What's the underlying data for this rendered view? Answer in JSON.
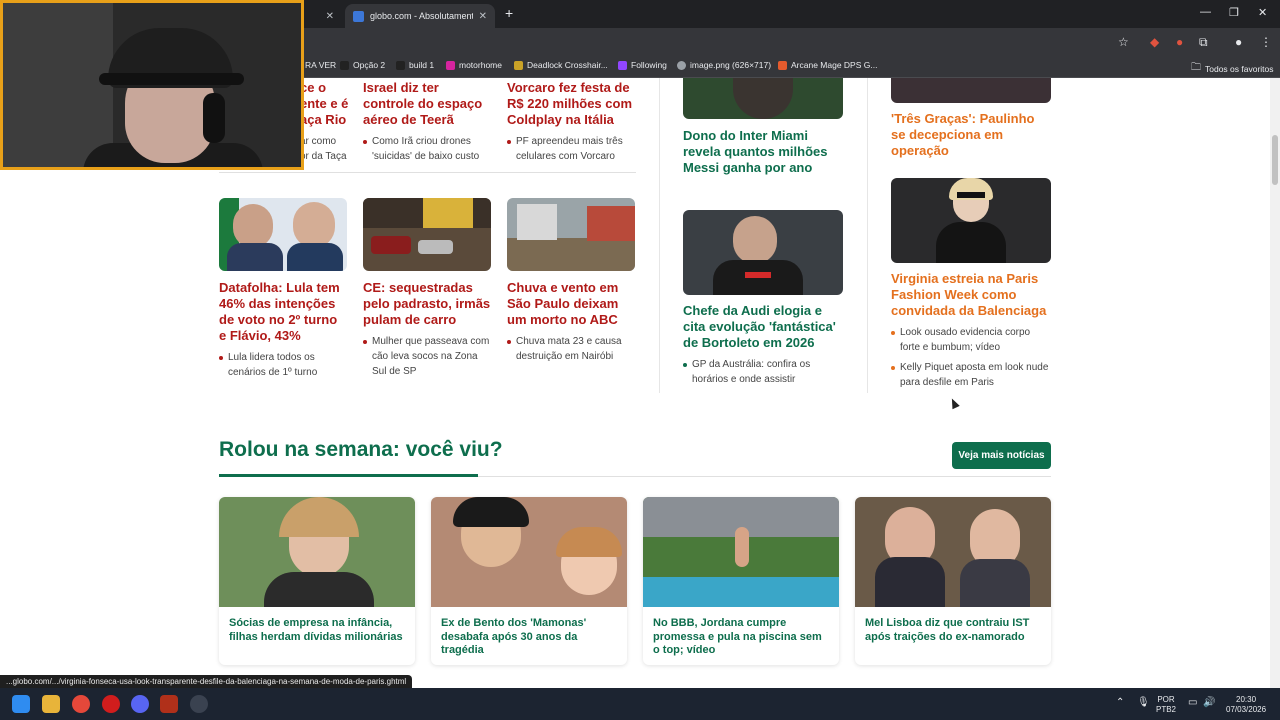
{
  "browser": {
    "inactive_tab_close": "✕",
    "active_tab_title": "globo.com - Absolutamente tu",
    "active_tab_close": "✕",
    "new_tab": "+",
    "bookmarks": [
      {
        "label": "RA VER",
        "color": "#3a3a3a"
      },
      {
        "label": "Opção 2",
        "color": "#222222"
      },
      {
        "label": "build 1",
        "color": "#222222"
      },
      {
        "label": "motorhome",
        "color": "#d6249f"
      },
      {
        "label": "Deadlock Crosshair...",
        "color": "#c9a227"
      },
      {
        "label": "Following",
        "color": "#9146ff"
      },
      {
        "label": "image.png (626×717)",
        "color": "#9aa0a6"
      },
      {
        "label": "Arcane Mage DPS G...",
        "color": "#e55b2d"
      }
    ],
    "all_favorites": "Todos os favoritos",
    "status_url": "...globo.com/.../virginia-fonseca-usa-look-transparente-desfile-da-balenciaga-na-semana-de-moda-de-paris.ghtml"
  },
  "top_row": {
    "col1": {
      "lines": [
        "ce o",
        "ente e é",
        "aça Rio"
      ],
      "sub": [
        "ar como",
        "or da Taça"
      ]
    },
    "col2": {
      "headline": "Israel diz ter controle do espaço aéreo de Teerã",
      "sub": "Como Irã criou drones 'suicidas' de baixo custo"
    },
    "col3": {
      "headline": "Vorcaro fez festa de R$ 220 milhões com Coldplay na Itália",
      "sub": "PF apreendeu mais três celulares com Vorcaro"
    }
  },
  "mid_row": [
    {
      "headline": "Datafolha: Lula tem 46% das intenções de voto no 2º turno e Flávio, 43%",
      "sub": "Lula lidera todos os cenários de 1º turno"
    },
    {
      "headline": "CE: sequestradas pelo padrasto, irmãs pulam de carro",
      "sub": "Mulher que passeava com cão leva socos na Zona Sul de SP"
    },
    {
      "headline": "Chuva e vento em São Paulo deixam um morto  no ABC",
      "sub": "Chuva mata 23 e causa destruição em Nairóbi"
    }
  ],
  "sports": {
    "top_headline": "Dono do Inter Miami revela quantos milhões Messi ganha por ano",
    "headline": "Chefe da Audi elogia e cita evolução 'fantástica' de Bortoleto em 2026",
    "sub": "GP da Austrália: confira os horários e onde assistir"
  },
  "entertainment": {
    "top_headline": "'Três Graças': Paulinho se decepciona em operação",
    "headline": "Virginia estreia na Paris Fashion Week como convidada da Balenciaga",
    "subs": [
      "Look ousado evidencia corpo forte e bumbum; vídeo",
      "Kelly Piquet aposta em look nude para desfile em Paris"
    ]
  },
  "weekly": {
    "title": "Rolou na semana: você viu?",
    "button": "Veja mais notícias",
    "cards": [
      {
        "text": "Sócias de empresa na infância, filhas herdam dívidas milionárias"
      },
      {
        "text": "Ex de Bento dos 'Mamonas' desabafa após 30 anos da tragédia"
      },
      {
        "text": "No BBB, Jordana cumpre promessa e pula na piscina sem o top; vídeo"
      },
      {
        "text": "Mel Lisboa diz que contraiu IST após traições do ex-namorado"
      }
    ]
  },
  "taskbar": {
    "lang": "POR",
    "layout": "PTB2",
    "time": "20:30",
    "date": "07/03/2026"
  }
}
